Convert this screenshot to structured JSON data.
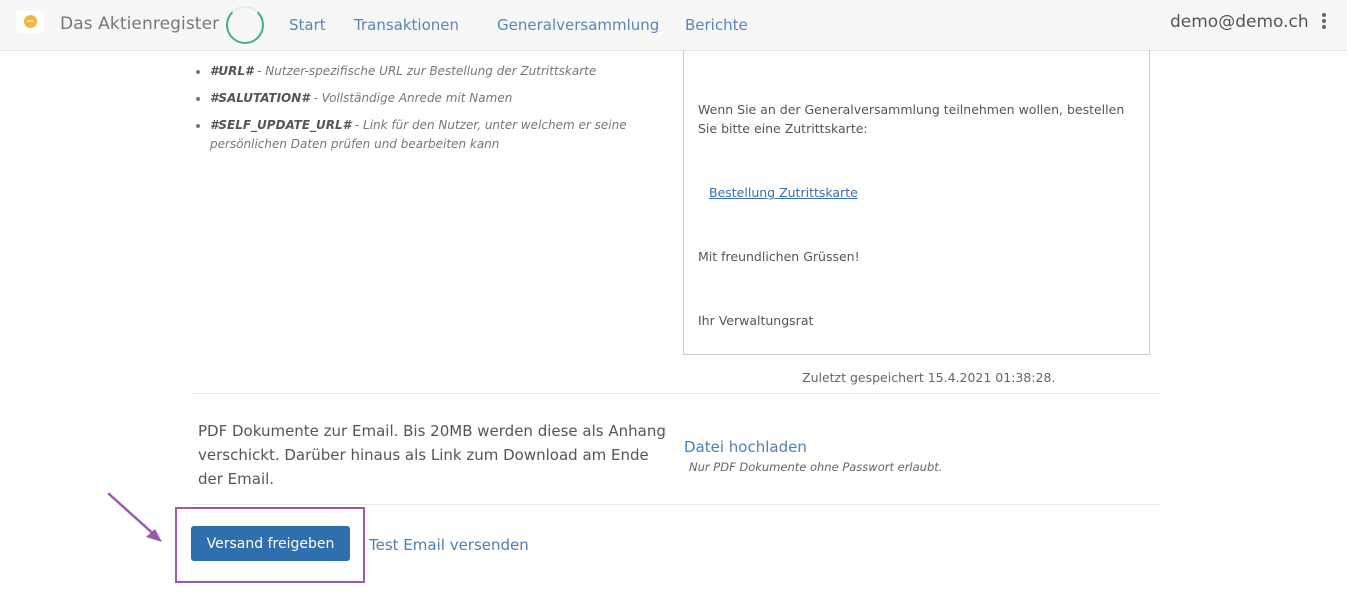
{
  "header": {
    "brand": "Das Aktienregister",
    "nav": [
      "Start",
      "Transaktionen",
      "Generalversammlung",
      "Berichte"
    ],
    "user_email": "demo@demo.ch"
  },
  "placeholders": [
    {
      "tag": "#URL#",
      "desc": " - Nutzer-spezifische URL zur Bestellung der Zutrittskarte"
    },
    {
      "tag": "#SALUTATION#",
      "desc": " - Vollständige Anrede mit Namen"
    },
    {
      "tag": "#SELF_UPDATE_URL#",
      "desc": " - Link für den Nutzer, unter welchem er seine persönlichen Daten prüfen und bearbeiten kann"
    }
  ],
  "preview": {
    "intro": "Wenn Sie an der Generalversammlung teilnehmen wollen, bestellen Sie bitte eine Zutrittskarte:",
    "link": "Bestellung Zutrittskarte",
    "closing": "Mit freundlichen Grüssen!",
    "signature": "Ihr Verwaltungsrat"
  },
  "saved_status": "Zuletzt gespeichert 15.4.2021 01:38:28.",
  "attachments": {
    "description": "PDF Dokumente zur Email. Bis 20MB werden diese als Anhang verschickt. Darüber hinaus als Link zum Download am Ende der Email.",
    "upload_label": "Datei hochladen",
    "upload_hint": "Nur PDF Dokumente ohne Passwort erlaubt."
  },
  "actions": {
    "release_label": "Versand freigeben",
    "test_label": "Test Email versenden"
  },
  "colors": {
    "primary": "#2f6fae",
    "link": "#4d7fb8",
    "highlight": "#9b59b6"
  }
}
